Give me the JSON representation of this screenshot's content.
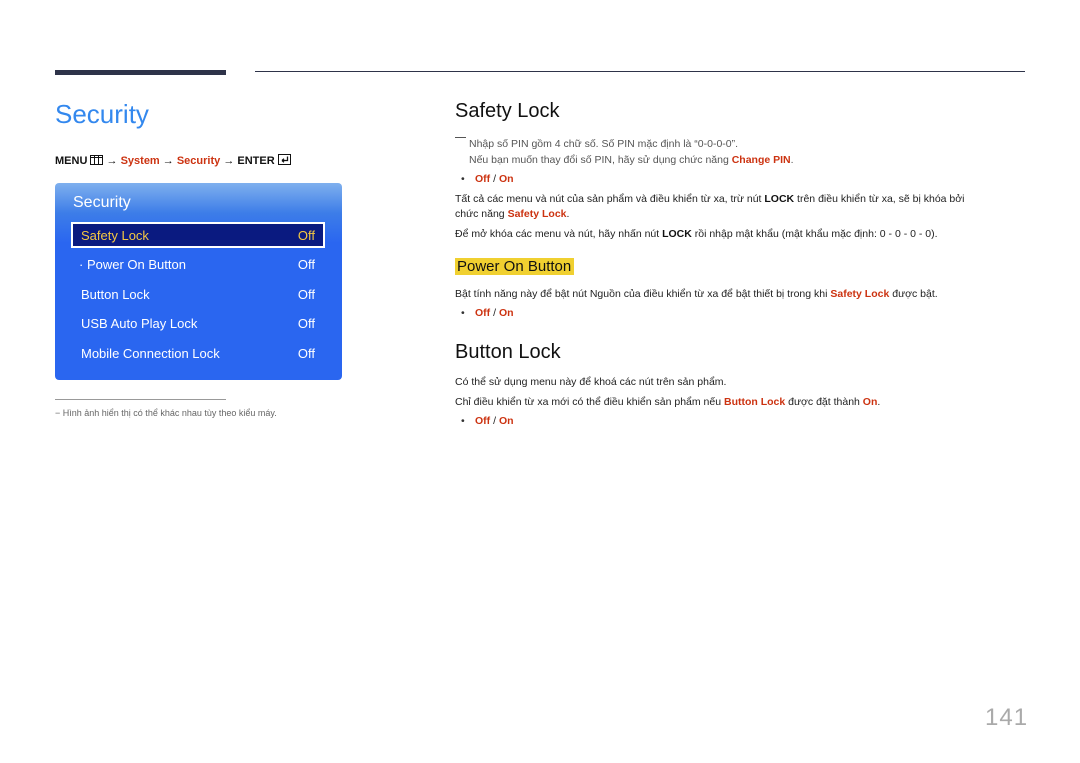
{
  "header": {
    "page_title": "Security"
  },
  "breadcrumb": {
    "menu": "MENU",
    "menu_icon": "menu-icon",
    "arrow": "→",
    "system": "System",
    "security": "Security",
    "enter": "ENTER",
    "enter_icon": "enter-icon"
  },
  "osd": {
    "title": "Security",
    "items": [
      {
        "label": "Safety Lock",
        "value": "Off",
        "selected": true
      },
      {
        "label": "· Power On Button",
        "value": "Off",
        "selected": false
      },
      {
        "label": "Button Lock",
        "value": "Off",
        "selected": false
      },
      {
        "label": "USB Auto Play Lock",
        "value": "Off",
        "selected": false
      },
      {
        "label": "Mobile Connection Lock",
        "value": "Off",
        "selected": false
      }
    ]
  },
  "footnote": "− Hình ảnh hiển thị có thể khác nhau tùy theo kiểu máy.",
  "safety_lock": {
    "heading": "Safety Lock",
    "note_line1": "Nhập số PIN gồm 4 chữ số. Số PIN mặc định là “0-0-0-0”.",
    "note_line2_pre": "Nếu bạn muốn thay đổi số PIN, hãy sử dụng chức năng ",
    "note_line2_link": "Change PIN",
    "note_line2_post": ".",
    "option_off": "Off",
    "option_sep": " / ",
    "option_on": "On",
    "para1_a": "Tất cả các menu và nút của sản phẩm và điều khiển từ xa, trừ nút ",
    "para1_b": "LOCK",
    "para1_c": " trên điều khiển từ xa, sẽ bị khóa bởi",
    "para1_d": "chức năng ",
    "para1_e": "Safety Lock",
    "para1_f": ".",
    "para2_a": "Để mở khóa các menu và nút, hãy nhấn nút ",
    "para2_b": "LOCK",
    "para2_c": " rồi nhập mật khẩu (mật khẩu mặc định: 0 - 0 - 0 - 0)."
  },
  "power_on_button": {
    "heading": "Power On Button",
    "para_a": "Bật tính năng này để bật nút Nguồn của điều khiển từ xa để bật thiết bị trong khi ",
    "para_b": "Safety Lock",
    "para_c": " được bật.",
    "option_off": "Off",
    "option_sep": " / ",
    "option_on": "On"
  },
  "button_lock": {
    "heading": "Button Lock",
    "para1": "Có thể sử dụng menu này để khoá các nút trên sản phẩm.",
    "para2_a": "Chỉ điều khiển từ xa mới có thể điều khiển sản phẩm nếu ",
    "para2_b": "Button Lock",
    "para2_c": " được đặt thành ",
    "para2_d": "On",
    "para2_e": ".",
    "option_off": "Off",
    "option_sep": " / ",
    "option_on": "On"
  },
  "page_number": "141",
  "colors": {
    "title_blue": "#3388ee",
    "link_red": "#cc3311",
    "osd_blue": "#2a66f0",
    "osd_selected": "#0a1a80",
    "highlight_yellow": "#f0d030"
  }
}
